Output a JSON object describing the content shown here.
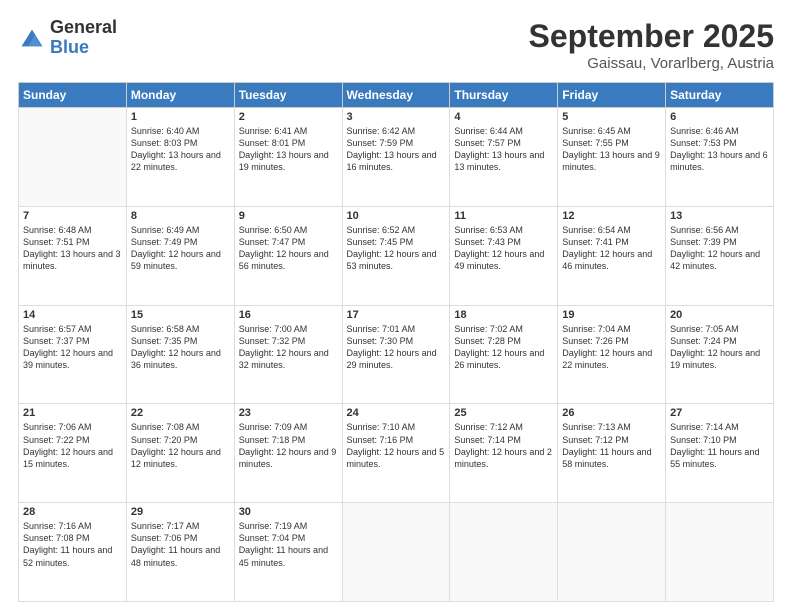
{
  "logo": {
    "general": "General",
    "blue": "Blue"
  },
  "title": {
    "month": "September 2025",
    "location": "Gaissau, Vorarlberg, Austria"
  },
  "weekdays": [
    "Sunday",
    "Monday",
    "Tuesday",
    "Wednesday",
    "Thursday",
    "Friday",
    "Saturday"
  ],
  "weeks": [
    [
      {
        "day": "",
        "sunrise": "",
        "sunset": "",
        "daylight": "",
        "empty": true
      },
      {
        "day": "1",
        "sunrise": "Sunrise: 6:40 AM",
        "sunset": "Sunset: 8:03 PM",
        "daylight": "Daylight: 13 hours and 22 minutes."
      },
      {
        "day": "2",
        "sunrise": "Sunrise: 6:41 AM",
        "sunset": "Sunset: 8:01 PM",
        "daylight": "Daylight: 13 hours and 19 minutes."
      },
      {
        "day": "3",
        "sunrise": "Sunrise: 6:42 AM",
        "sunset": "Sunset: 7:59 PM",
        "daylight": "Daylight: 13 hours and 16 minutes."
      },
      {
        "day": "4",
        "sunrise": "Sunrise: 6:44 AM",
        "sunset": "Sunset: 7:57 PM",
        "daylight": "Daylight: 13 hours and 13 minutes."
      },
      {
        "day": "5",
        "sunrise": "Sunrise: 6:45 AM",
        "sunset": "Sunset: 7:55 PM",
        "daylight": "Daylight: 13 hours and 9 minutes."
      },
      {
        "day": "6",
        "sunrise": "Sunrise: 6:46 AM",
        "sunset": "Sunset: 7:53 PM",
        "daylight": "Daylight: 13 hours and 6 minutes."
      }
    ],
    [
      {
        "day": "7",
        "sunrise": "Sunrise: 6:48 AM",
        "sunset": "Sunset: 7:51 PM",
        "daylight": "Daylight: 13 hours and 3 minutes."
      },
      {
        "day": "8",
        "sunrise": "Sunrise: 6:49 AM",
        "sunset": "Sunset: 7:49 PM",
        "daylight": "Daylight: 12 hours and 59 minutes."
      },
      {
        "day": "9",
        "sunrise": "Sunrise: 6:50 AM",
        "sunset": "Sunset: 7:47 PM",
        "daylight": "Daylight: 12 hours and 56 minutes."
      },
      {
        "day": "10",
        "sunrise": "Sunrise: 6:52 AM",
        "sunset": "Sunset: 7:45 PM",
        "daylight": "Daylight: 12 hours and 53 minutes."
      },
      {
        "day": "11",
        "sunrise": "Sunrise: 6:53 AM",
        "sunset": "Sunset: 7:43 PM",
        "daylight": "Daylight: 12 hours and 49 minutes."
      },
      {
        "day": "12",
        "sunrise": "Sunrise: 6:54 AM",
        "sunset": "Sunset: 7:41 PM",
        "daylight": "Daylight: 12 hours and 46 minutes."
      },
      {
        "day": "13",
        "sunrise": "Sunrise: 6:56 AM",
        "sunset": "Sunset: 7:39 PM",
        "daylight": "Daylight: 12 hours and 42 minutes."
      }
    ],
    [
      {
        "day": "14",
        "sunrise": "Sunrise: 6:57 AM",
        "sunset": "Sunset: 7:37 PM",
        "daylight": "Daylight: 12 hours and 39 minutes."
      },
      {
        "day": "15",
        "sunrise": "Sunrise: 6:58 AM",
        "sunset": "Sunset: 7:35 PM",
        "daylight": "Daylight: 12 hours and 36 minutes."
      },
      {
        "day": "16",
        "sunrise": "Sunrise: 7:00 AM",
        "sunset": "Sunset: 7:32 PM",
        "daylight": "Daylight: 12 hours and 32 minutes."
      },
      {
        "day": "17",
        "sunrise": "Sunrise: 7:01 AM",
        "sunset": "Sunset: 7:30 PM",
        "daylight": "Daylight: 12 hours and 29 minutes."
      },
      {
        "day": "18",
        "sunrise": "Sunrise: 7:02 AM",
        "sunset": "Sunset: 7:28 PM",
        "daylight": "Daylight: 12 hours and 26 minutes."
      },
      {
        "day": "19",
        "sunrise": "Sunrise: 7:04 AM",
        "sunset": "Sunset: 7:26 PM",
        "daylight": "Daylight: 12 hours and 22 minutes."
      },
      {
        "day": "20",
        "sunrise": "Sunrise: 7:05 AM",
        "sunset": "Sunset: 7:24 PM",
        "daylight": "Daylight: 12 hours and 19 minutes."
      }
    ],
    [
      {
        "day": "21",
        "sunrise": "Sunrise: 7:06 AM",
        "sunset": "Sunset: 7:22 PM",
        "daylight": "Daylight: 12 hours and 15 minutes."
      },
      {
        "day": "22",
        "sunrise": "Sunrise: 7:08 AM",
        "sunset": "Sunset: 7:20 PM",
        "daylight": "Daylight: 12 hours and 12 minutes."
      },
      {
        "day": "23",
        "sunrise": "Sunrise: 7:09 AM",
        "sunset": "Sunset: 7:18 PM",
        "daylight": "Daylight: 12 hours and 9 minutes."
      },
      {
        "day": "24",
        "sunrise": "Sunrise: 7:10 AM",
        "sunset": "Sunset: 7:16 PM",
        "daylight": "Daylight: 12 hours and 5 minutes."
      },
      {
        "day": "25",
        "sunrise": "Sunrise: 7:12 AM",
        "sunset": "Sunset: 7:14 PM",
        "daylight": "Daylight: 12 hours and 2 minutes."
      },
      {
        "day": "26",
        "sunrise": "Sunrise: 7:13 AM",
        "sunset": "Sunset: 7:12 PM",
        "daylight": "Daylight: 11 hours and 58 minutes."
      },
      {
        "day": "27",
        "sunrise": "Sunrise: 7:14 AM",
        "sunset": "Sunset: 7:10 PM",
        "daylight": "Daylight: 11 hours and 55 minutes."
      }
    ],
    [
      {
        "day": "28",
        "sunrise": "Sunrise: 7:16 AM",
        "sunset": "Sunset: 7:08 PM",
        "daylight": "Daylight: 11 hours and 52 minutes."
      },
      {
        "day": "29",
        "sunrise": "Sunrise: 7:17 AM",
        "sunset": "Sunset: 7:06 PM",
        "daylight": "Daylight: 11 hours and 48 minutes."
      },
      {
        "day": "30",
        "sunrise": "Sunrise: 7:19 AM",
        "sunset": "Sunset: 7:04 PM",
        "daylight": "Daylight: 11 hours and 45 minutes."
      },
      {
        "day": "",
        "sunrise": "",
        "sunset": "",
        "daylight": "",
        "empty": true
      },
      {
        "day": "",
        "sunrise": "",
        "sunset": "",
        "daylight": "",
        "empty": true
      },
      {
        "day": "",
        "sunrise": "",
        "sunset": "",
        "daylight": "",
        "empty": true
      },
      {
        "day": "",
        "sunrise": "",
        "sunset": "",
        "daylight": "",
        "empty": true
      }
    ]
  ]
}
